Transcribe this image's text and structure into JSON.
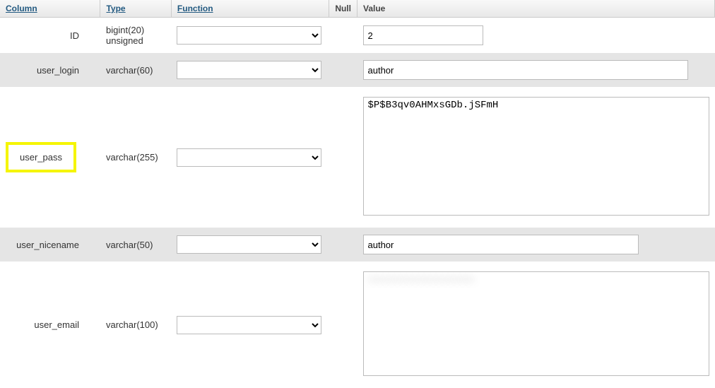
{
  "headers": {
    "column": "Column",
    "type": "Type",
    "function": "Function",
    "null": "Null",
    "value": "Value"
  },
  "rows": [
    {
      "column": "ID",
      "type": "bigint(20) unsigned",
      "value": "2",
      "input_kind": "short",
      "shade": "odd",
      "highlight": false
    },
    {
      "column": "user_login",
      "type": "varchar(60)",
      "value": "author",
      "input_kind": "med",
      "shade": "even",
      "highlight": false
    },
    {
      "column": "user_pass",
      "type": "varchar(255)",
      "value": "$P$B3qv0AHMxsGDb.jSFmH",
      "input_kind": "textarea",
      "shade": "odd",
      "highlight": true
    },
    {
      "column": "user_nicename",
      "type": "varchar(50)",
      "value": "author",
      "input_kind": "med2",
      "shade": "even",
      "highlight": false
    },
    {
      "column": "user_email",
      "type": "varchar(100)",
      "value": "",
      "input_kind": "textarea_redacted",
      "shade": "odd",
      "highlight": false
    }
  ]
}
